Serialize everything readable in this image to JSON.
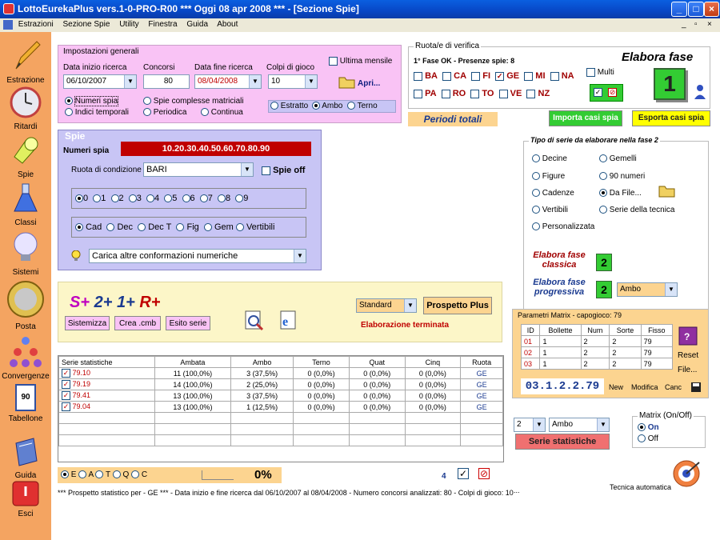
{
  "window": {
    "title": "LottoEurekaPlus vers.1-0-PRO-R00  ***  Oggi 08 apr 2008  ***  - [Sezione Spie]",
    "min": "_",
    "max": "□",
    "close": "×"
  },
  "menu": {
    "items": [
      "Estrazioni",
      "Sezione Spie",
      "Utility",
      "Finestra",
      "Guida",
      "About"
    ],
    "right_controls": [
      "_",
      "▫",
      "×"
    ]
  },
  "sidebar": {
    "items": [
      "Estrazione",
      "Ritardi",
      "Spie",
      "Classi",
      "Sistemi",
      "Posta",
      "Convergenze",
      "Tabellone",
      "Guida",
      "Esci"
    ],
    "tabellone_num": "90"
  },
  "settings": {
    "title": "Impostazioni generali",
    "start_label": "Data inizio ricerca",
    "start_value": "06/10/2007",
    "concorsi_label": "Concorsi",
    "concorsi_value": "80",
    "end_label": "Data fine ricerca",
    "end_value": "08/04/2008",
    "colpi_label": "Colpi di gioco",
    "colpi_value": "10",
    "ultima_label": "Ultima mensile",
    "apri_label": "Apri...",
    "radio_numeri": "Numeri spia",
    "radio_indici": "Indici temporali",
    "radio_spie": "Spie complesse matriciali",
    "radio_periodica": "Periodica",
    "radio_continua": "Continua",
    "radio_estratto": "Estratto",
    "radio_ambo": "Ambo",
    "radio_terno": "Terno"
  },
  "ruota": {
    "title": "Ruota/e di verifica",
    "fase": "1° Fase OK - Presenze spie: 8",
    "elabora": "Elabora fase",
    "fase_num": "1",
    "multi": "Multi",
    "wheels_row1": [
      "BA",
      "CA",
      "FI",
      "GE",
      "MI",
      "NA"
    ],
    "wheels_row2": [
      "PA",
      "RO",
      "TO",
      "VE",
      "NZ"
    ],
    "check": "✓",
    "cancel": "⊘"
  },
  "periodi": "Periodi totali",
  "importa": "Importa casi spia",
  "esporta": "Esporta casi spia",
  "spie": {
    "title": "Spie",
    "numeri_label": "Numeri spia",
    "numeri_value": "10.20.30.40.50.60.70.80.90",
    "ruota_label": "Ruota di condizione",
    "ruota_value": "BARI",
    "spie_off": "Spie off",
    "digits": [
      "0",
      "1",
      "2",
      "3",
      "4",
      "5",
      "6",
      "7",
      "8",
      "9"
    ],
    "types": [
      "Cad",
      "Dec",
      "Dec T",
      "Fig",
      "Gem",
      "Vertibili"
    ],
    "carica": "Carica altre conformazioni numeriche"
  },
  "tipo": {
    "title": "Tipo di serie da elaborare nella fase 2",
    "left": [
      "Decine",
      "Figure",
      "Cadenze",
      "Vertibili",
      "Personalizzata"
    ],
    "right": [
      "Gemelli",
      "90 numeri",
      "Da File...",
      "Serie della tecnica"
    ],
    "classica": "Elabora fase classica",
    "progressiva": "Elabora fase progressiva",
    "fase2": "2",
    "ambo": "Ambo"
  },
  "tools": {
    "s": "S+",
    "two": "2+",
    "one": "1+",
    "r": "R+",
    "sistemizza": "Sistemizza",
    "crea": "Crea .cmb",
    "esito": "Esito serie",
    "standard": "Standard",
    "prospetto": "Prospetto Plus",
    "terminata": "Elaborazione terminata"
  },
  "matrix": {
    "title": "Parametri Matrix - capogioco: 79",
    "headers": [
      "ID",
      "Bollette",
      "Num",
      "Sorte",
      "Fisso"
    ],
    "rows": [
      [
        "01",
        "1",
        "2",
        "2",
        "79"
      ],
      [
        "02",
        "1",
        "2",
        "2",
        "79"
      ],
      [
        "03",
        "1",
        "2",
        "2",
        "79"
      ]
    ],
    "reset": "Reset",
    "file": "File...",
    "code": "03.1.2.2.79",
    "new": "New",
    "modifica": "Modifica",
    "canc": "Canc"
  },
  "stats": {
    "headers": [
      "Serie statistiche",
      "Ambata",
      "Ambo",
      "Terno",
      "Quat",
      "Cinq",
      "Ruota"
    ],
    "rows": [
      [
        "79.10",
        "11 (100,0%)",
        "3 (37,5%)",
        "0 (0,0%)",
        "0 (0,0%)",
        "0 (0,0%)",
        "GE"
      ],
      [
        "79.19",
        "14 (100,0%)",
        "2 (25,0%)",
        "0 (0,0%)",
        "0 (0,0%)",
        "0 (0,0%)",
        "GE"
      ],
      [
        "79.41",
        "13 (100,0%)",
        "3 (37,5%)",
        "0 (0,0%)",
        "0 (0,0%)",
        "0 (0,0%)",
        "GE"
      ],
      [
        "79.04",
        "13 (100,0%)",
        "1 (12,5%)",
        "0 (0,0%)",
        "0 (0,0%)",
        "0 (0,0%)",
        "GE"
      ]
    ]
  },
  "serie": {
    "num": "2",
    "ambo": "Ambo",
    "btn": "Serie statistiche",
    "matrix_title": "Matrix (On/Off)",
    "on": "On",
    "off": "Off"
  },
  "bottom": {
    "letters": [
      "E",
      "A",
      "T",
      "Q",
      "C"
    ],
    "percent": "0%",
    "count": "4",
    "check": "✓",
    "cancel": "⊘",
    "status": "*** Prospetto statistico per  - GE ***  - Data inizio e fine ricerca dal 06/10/2007 al 08/04/2008 - Numero concorsi analizzati: 80 - Colpi di gioco: 10",
    "dots": "...",
    "tecnica": "Tecnica automatica"
  },
  "colors": {
    "pink": "#f9c3f5",
    "blue": "#c8c5f5",
    "red": "#c00000",
    "green": "#33cc33",
    "yellow": "#ffff00",
    "orange": "#f4a461"
  }
}
